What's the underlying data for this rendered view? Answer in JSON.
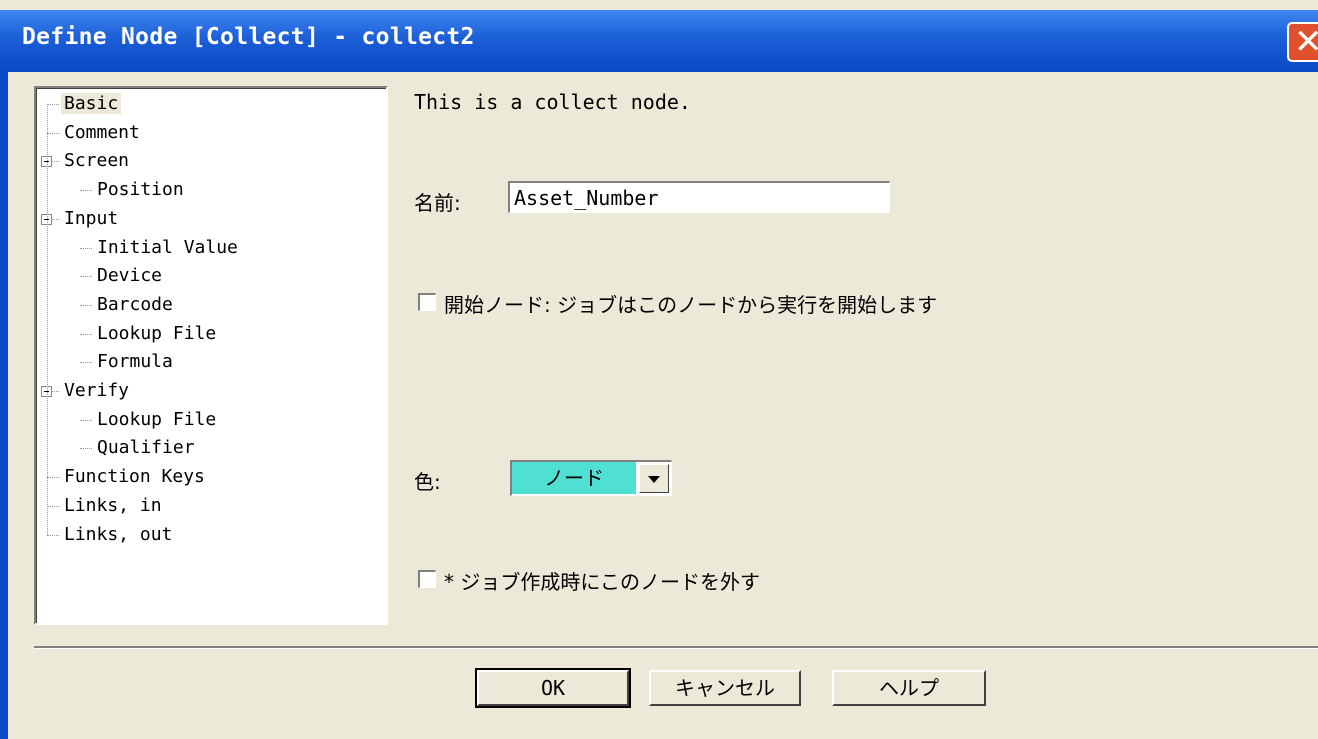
{
  "window": {
    "title": "Define Node [Collect] - collect2",
    "close_symbol": "✕"
  },
  "tree": [
    {
      "label": "Basic",
      "level": 0,
      "selected": true
    },
    {
      "label": "Comment",
      "level": 0
    },
    {
      "label": "Screen",
      "level": 0,
      "expanded": true
    },
    {
      "label": "Position",
      "level": 1
    },
    {
      "label": "Input",
      "level": 0,
      "expanded": true
    },
    {
      "label": "Initial Value",
      "level": 1
    },
    {
      "label": "Device",
      "level": 1
    },
    {
      "label": "Barcode",
      "level": 1
    },
    {
      "label": "Lookup File",
      "level": 1
    },
    {
      "label": "Formula",
      "level": 1
    },
    {
      "label": "Verify",
      "level": 0,
      "expanded": true
    },
    {
      "label": "Lookup File",
      "level": 1
    },
    {
      "label": "Qualifier",
      "level": 1
    },
    {
      "label": "Function Keys",
      "level": 0
    },
    {
      "label": "Links, in",
      "level": 0
    },
    {
      "label": "Links, out",
      "level": 0
    }
  ],
  "panel": {
    "description": "This is a collect node.",
    "name_label": "名前:",
    "name_value": "Asset_Number",
    "start_node_label": "開始ノード: ジョブはこのノードから実行を開始します",
    "start_node_checked": false,
    "color_label": "色:",
    "color_value": "ノード",
    "color_swatch": "#4fe0d3",
    "exclude_label": "* ジョブ作成時にこのノードを外す",
    "exclude_checked": false
  },
  "buttons": {
    "ok": "OK",
    "cancel": "キャンセル",
    "help": "ヘルプ"
  }
}
